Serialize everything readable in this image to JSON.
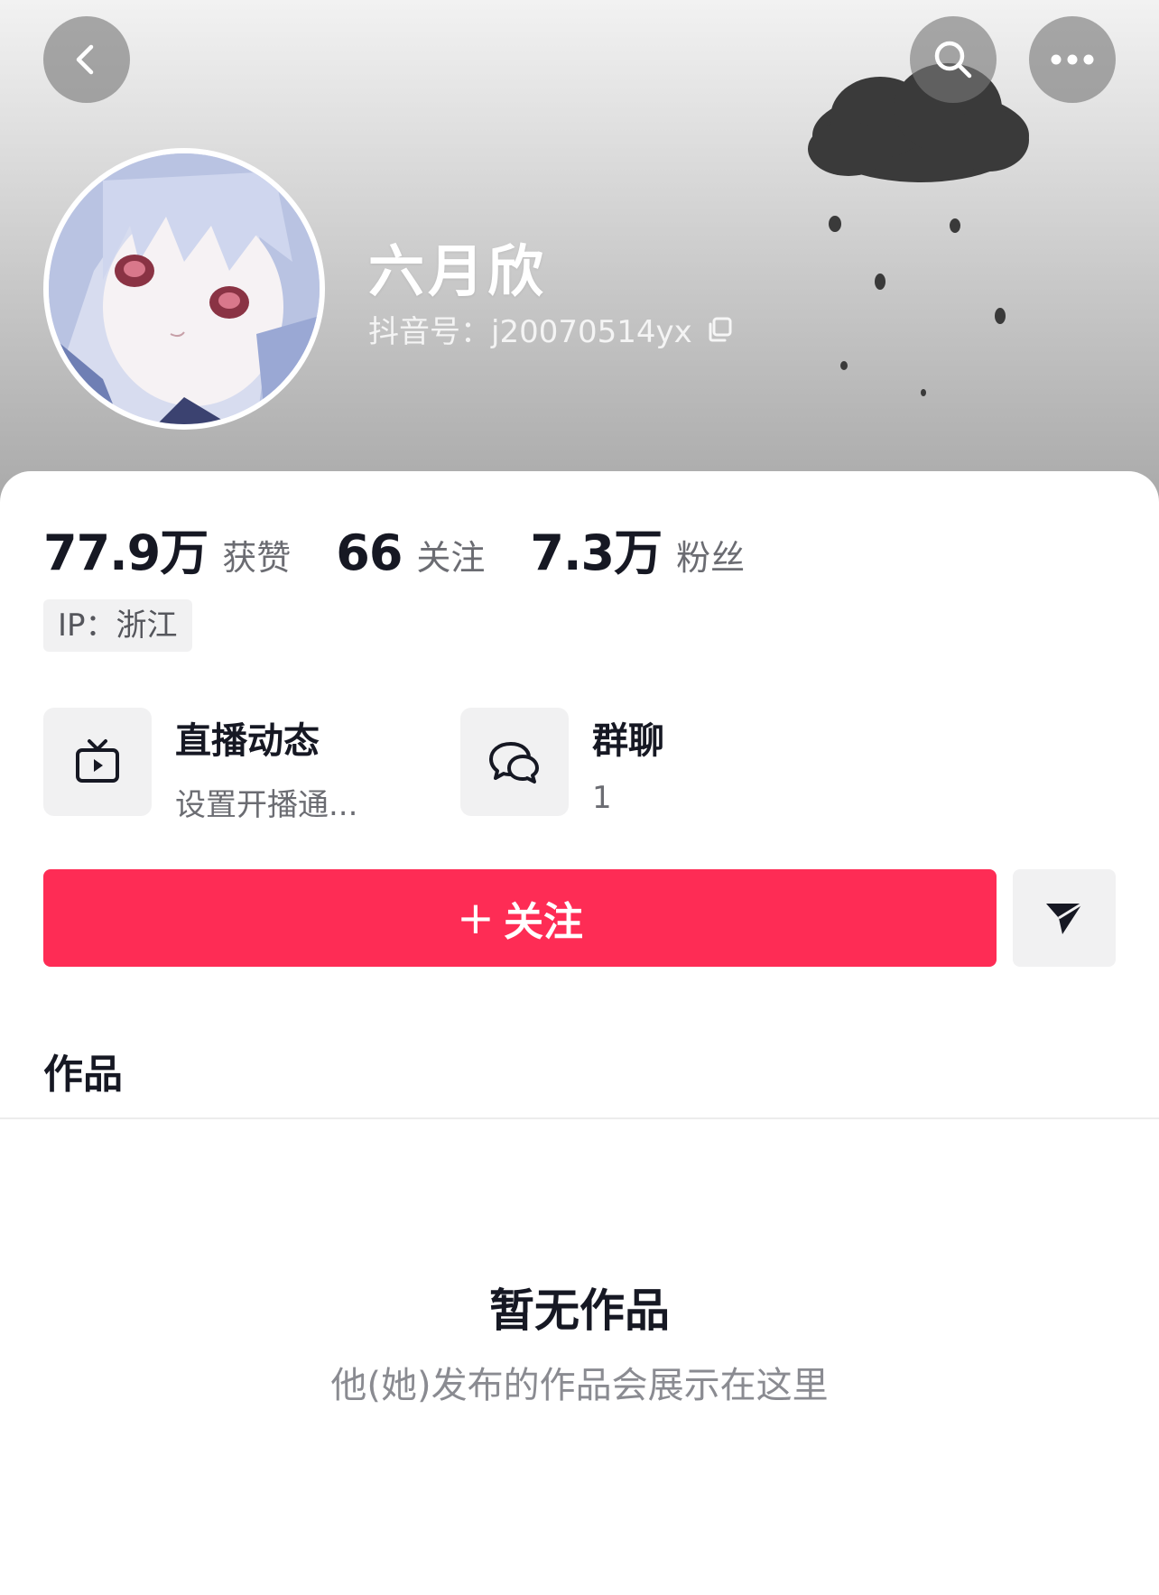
{
  "header": {
    "back_icon": "chevron-left-icon",
    "search_icon": "search-icon",
    "more_icon": "more-dots-icon"
  },
  "profile": {
    "nickname": "六月欣",
    "douyin_id": "抖音号：j20070514yx",
    "copy_icon": "copy-icon"
  },
  "stats": [
    {
      "value": "77.9万",
      "label": "获赞"
    },
    {
      "value": "66",
      "label": "关注"
    },
    {
      "value": "7.3万",
      "label": "粉丝"
    }
  ],
  "ip_tag": "IP：浙江",
  "features": {
    "live": {
      "icon": "tv-play-icon",
      "title": "直播动态",
      "subtitle": "设置开播通..."
    },
    "group": {
      "icon": "chat-bubbles-icon",
      "title": "群聊",
      "subtitle": "1"
    }
  },
  "actions": {
    "follow_plus": "+",
    "follow_label": "关注",
    "share_icon": "send-icon"
  },
  "tabs": {
    "works_label": "作品"
  },
  "empty_state": {
    "title": "暂无作品",
    "subtitle": "他(她)发布的作品会展示在这里"
  },
  "colors": {
    "primary": "#fe2c55",
    "text": "#161823",
    "secondary_text": "#6b6c72",
    "chip_bg": "#f1f1f2"
  }
}
